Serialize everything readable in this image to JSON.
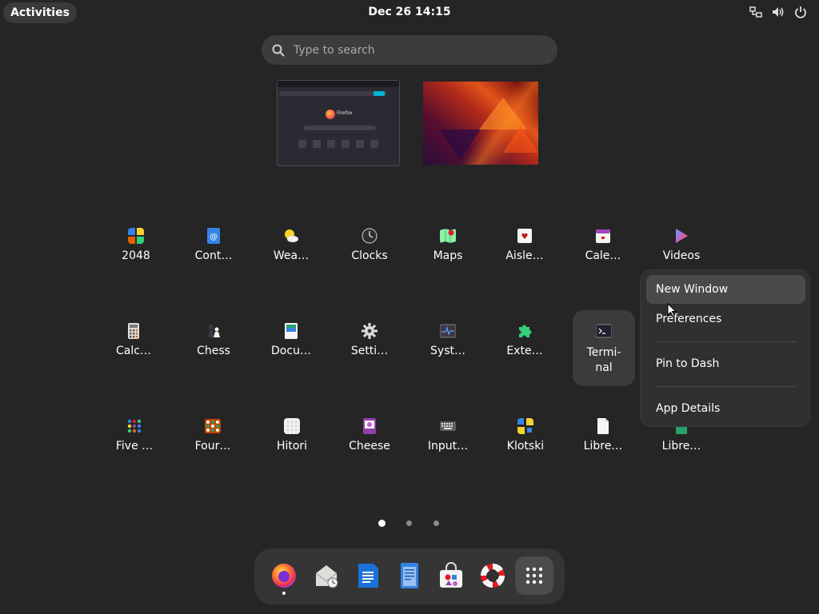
{
  "topbar": {
    "activities_label": "Activities",
    "clock": "Dec 26  14:15",
    "icons": [
      "network-icon",
      "volume-icon",
      "power-icon"
    ]
  },
  "search": {
    "placeholder": "Type to search"
  },
  "thumbnails": {
    "firefox_label": "Firefox"
  },
  "apps": [
    {
      "label": "2048",
      "icon": "2048-icon"
    },
    {
      "label": "Cont…",
      "icon": "contacts-icon"
    },
    {
      "label": "Wea…",
      "icon": "weather-icon"
    },
    {
      "label": "Clocks",
      "icon": "clocks-icon"
    },
    {
      "label": "Maps",
      "icon": "maps-icon"
    },
    {
      "label": "Aisle…",
      "icon": "aisleriot-icon"
    },
    {
      "label": "Cale…",
      "icon": "calendar-icon"
    },
    {
      "label": "Videos",
      "icon": "videos-icon"
    },
    {
      "label": "Calc…",
      "icon": "calculator-icon"
    },
    {
      "label": "Chess",
      "icon": "chess-icon"
    },
    {
      "label": "Docu…",
      "icon": "document-viewer-icon"
    },
    {
      "label": "Setti…",
      "icon": "settings-icon"
    },
    {
      "label": "Syst…",
      "icon": "system-monitor-icon"
    },
    {
      "label": "Exte…",
      "icon": "extensions-icon"
    },
    {
      "label": "Termi-\nnal",
      "label_line1": "Termi-",
      "label_line2": "nal",
      "icon": "terminal-icon"
    },
    {
      "label": "Five …",
      "icon": "five-or-more-icon"
    },
    {
      "label": "Four…",
      "icon": "four-in-a-row-icon"
    },
    {
      "label": "Hitori",
      "icon": "hitori-icon"
    },
    {
      "label": "Cheese",
      "icon": "cheese-icon"
    },
    {
      "label": "Input…",
      "icon": "input-method-icon"
    },
    {
      "label": "Klotski",
      "icon": "klotski-icon"
    },
    {
      "label": "Libre…",
      "icon": "libreoffice-icon"
    },
    {
      "label": "Libre…",
      "icon": "libreoffice-calc-icon"
    }
  ],
  "pager": {
    "pages": 3,
    "active": 1
  },
  "dash": {
    "items": [
      "firefox-icon",
      "mail-clock-icon",
      "writer-icon",
      "text-editor-icon",
      "software-icon",
      "help-icon",
      "show-apps-icon"
    ]
  },
  "context_menu": {
    "new_window": "New Window",
    "preferences": "Preferences",
    "pin_to_dash": "Pin to Dash",
    "app_details": "App Details"
  },
  "colors": {
    "background": "#252526",
    "menu_bg": "#303030",
    "hover_bg": "#4a4a4a"
  }
}
